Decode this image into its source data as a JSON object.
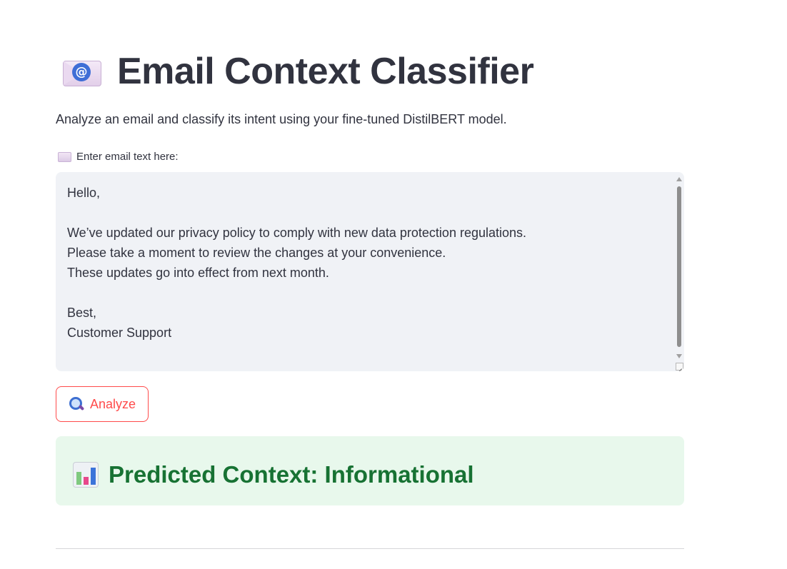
{
  "app": {
    "title": "Email Context Classifier",
    "title_icon": "envelope-with-at-icon",
    "subtitle": "Analyze an email and classify its intent using your fine-tuned DistilBERT model."
  },
  "email_input": {
    "label": "Enter email text here:",
    "label_icon": "envelope-icon",
    "value": "Hello,\n\nWe’ve updated our privacy policy to comply with new data protection regulations.\nPlease take a moment to review the changes at your convenience.\nThese updates go into effect from next month.\n\nBest,\nCustomer Support"
  },
  "analyze_button": {
    "label": "Analyze",
    "icon": "magnifier-icon"
  },
  "result": {
    "icon": "bar-chart-icon",
    "text": "Predicted Context: Informational"
  },
  "colors": {
    "accent": "#ff4b4b",
    "text": "#31333f",
    "input_bg": "#f0f2f6",
    "success_bg": "#e8f8ec",
    "success_text": "#177233"
  }
}
